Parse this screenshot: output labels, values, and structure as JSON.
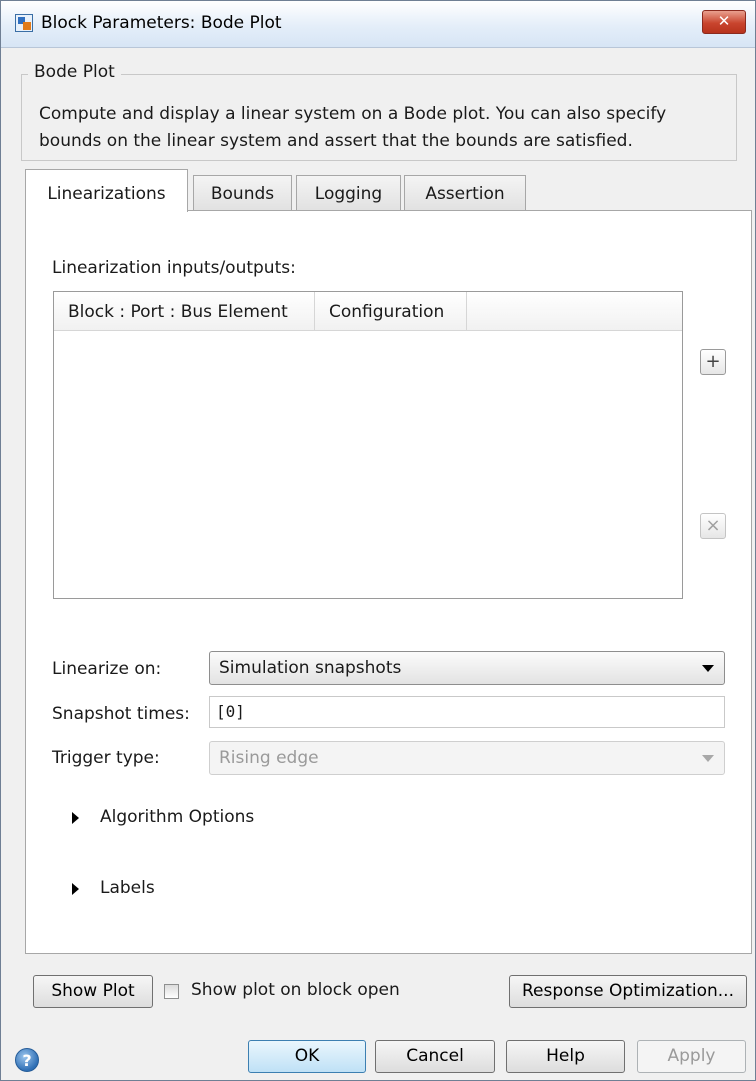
{
  "window": {
    "title": "Block Parameters: Bode Plot",
    "close_glyph": "✕",
    "icon": "simulink-block-icon"
  },
  "group": {
    "legend": "Bode Plot",
    "description_line1": "Compute and display a linear system on a Bode plot. You can also specify",
    "description_line2": "bounds on the linear system and assert that the bounds are satisfied."
  },
  "tabs": [
    {
      "label": "Linearizations",
      "active": true
    },
    {
      "label": "Bounds",
      "active": false
    },
    {
      "label": "Logging",
      "active": false
    },
    {
      "label": "Assertion",
      "active": false
    }
  ],
  "linearizations": {
    "io_label": "Linearization inputs/outputs:",
    "table_columns": [
      "Block : Port : Bus Element",
      "Configuration"
    ],
    "table_rows": [],
    "add_button": "+",
    "remove_button": "×",
    "linearize_on_label": "Linearize on:",
    "linearize_on_value": "Simulation snapshots",
    "snapshot_times_label": "Snapshot times:",
    "snapshot_times_value": "[0]",
    "trigger_type_label": "Trigger type:",
    "trigger_type_value": "Rising edge",
    "algorithm_options": "Algorithm Options",
    "labels": "Labels"
  },
  "footer": {
    "show_plot": "Show Plot",
    "show_plot_on_open": "Show plot on block open",
    "show_plot_on_open_checked": false,
    "response_optimization": "Response Optimization...",
    "help_glyph": "?",
    "ok": "OK",
    "cancel": "Cancel",
    "help": "Help",
    "apply": "Apply"
  }
}
